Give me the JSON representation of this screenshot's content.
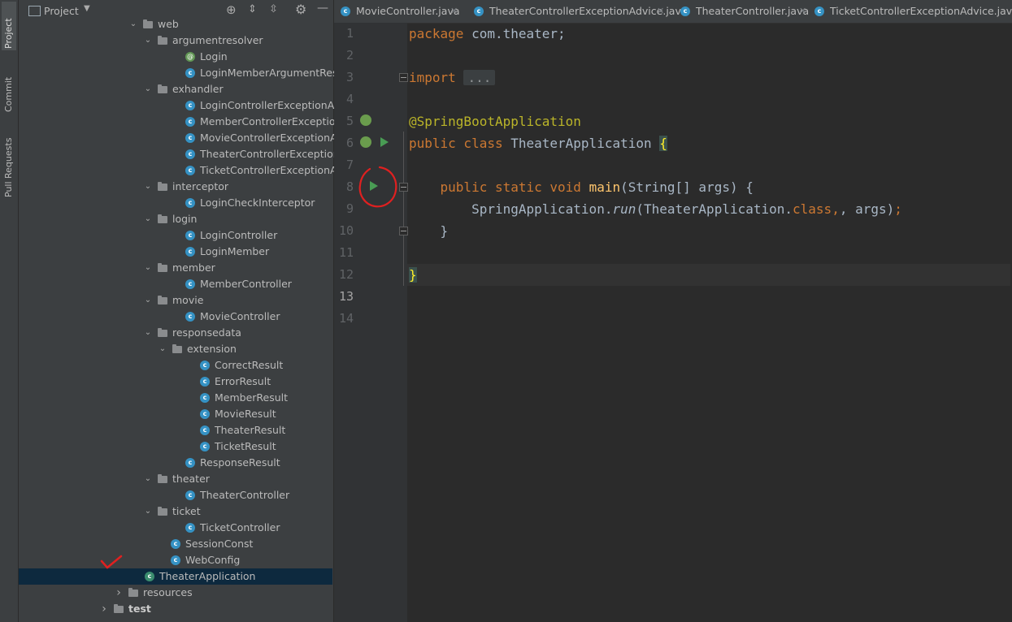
{
  "sidebar_tabs": [
    "Project",
    "Commit",
    "Pull Requests"
  ],
  "panel": {
    "title": "Project"
  },
  "tree": [
    {
      "label": "web",
      "type": "folder",
      "expanded": true,
      "indent": 0
    },
    {
      "label": "argumentresolver",
      "type": "folder",
      "expanded": true,
      "indent": 1
    },
    {
      "label": "Login",
      "type": "annotation",
      "indent": 2
    },
    {
      "label": "LoginMemberArgumentResolver",
      "type": "class",
      "indent": 2
    },
    {
      "label": "exhandler",
      "type": "folder",
      "expanded": true,
      "indent": 1
    },
    {
      "label": "LoginControllerExceptionAdvice",
      "type": "class",
      "indent": 2
    },
    {
      "label": "MemberControllerExceptionAdvice",
      "type": "class",
      "indent": 2
    },
    {
      "label": "MovieControllerExceptionAdvice",
      "type": "class",
      "indent": 2
    },
    {
      "label": "TheaterControllerExceptionAdvice",
      "type": "class",
      "indent": 2
    },
    {
      "label": "TicketControllerExceptionAdvice",
      "type": "class",
      "indent": 2
    },
    {
      "label": "interceptor",
      "type": "folder",
      "expanded": true,
      "indent": 1
    },
    {
      "label": "LoginCheckInterceptor",
      "type": "class",
      "indent": 2
    },
    {
      "label": "login",
      "type": "folder",
      "expanded": true,
      "indent": 1
    },
    {
      "label": "LoginController",
      "type": "class",
      "indent": 2
    },
    {
      "label": "LoginMember",
      "type": "class",
      "indent": 2
    },
    {
      "label": "member",
      "type": "folder",
      "expanded": true,
      "indent": 1
    },
    {
      "label": "MemberController",
      "type": "class",
      "indent": 2
    },
    {
      "label": "movie",
      "type": "folder",
      "expanded": true,
      "indent": 1
    },
    {
      "label": "MovieController",
      "type": "class",
      "indent": 2
    },
    {
      "label": "responsedata",
      "type": "folder",
      "expanded": true,
      "indent": 1
    },
    {
      "label": "extension",
      "type": "folder",
      "expanded": true,
      "indent": 2
    },
    {
      "label": "CorrectResult",
      "type": "class",
      "indent": 3
    },
    {
      "label": "ErrorResult",
      "type": "class",
      "indent": 3
    },
    {
      "label": "MemberResult",
      "type": "class",
      "indent": 3
    },
    {
      "label": "MovieResult",
      "type": "class",
      "indent": 3
    },
    {
      "label": "TheaterResult",
      "type": "class",
      "indent": 3
    },
    {
      "label": "TicketResult",
      "type": "class",
      "indent": 3
    },
    {
      "label": "ResponseResult",
      "type": "class",
      "indent": 2
    },
    {
      "label": "theater",
      "type": "folder",
      "expanded": true,
      "indent": 1
    },
    {
      "label": "TheaterController",
      "type": "class",
      "indent": 2
    },
    {
      "label": "ticket",
      "type": "folder",
      "expanded": true,
      "indent": 1
    },
    {
      "label": "TicketController",
      "type": "class",
      "indent": 2
    },
    {
      "label": "SessionConst",
      "type": "class",
      "indent": 1
    },
    {
      "label": "WebConfig",
      "type": "class",
      "indent": 1
    },
    {
      "label": "TheaterApplication",
      "type": "spring",
      "indent": 0,
      "selected": true
    },
    {
      "label": "resources",
      "type": "resfolder",
      "expanded": false,
      "indent": -1
    },
    {
      "label": "test",
      "type": "folder",
      "expanded": false,
      "indent": -2
    }
  ],
  "tabs": [
    {
      "label": "MovieController.java"
    },
    {
      "label": "TheaterControllerExceptionAdvice.java"
    },
    {
      "label": "TheaterController.java"
    },
    {
      "label": "TicketControllerExceptionAdvice.java"
    }
  ],
  "line_numbers": [
    "1",
    "2",
    "3",
    "4",
    "5",
    "6",
    "7",
    "8",
    "9",
    "10",
    "11",
    "12",
    "13",
    "14"
  ],
  "code": {
    "l1_kw": "package",
    "l1_rest": " com.theater;",
    "l3_kw": "import",
    "l3_fold": "...",
    "l6_ann": "@SpringBootApplication",
    "l7_kw": "public class",
    "l7_name": " TheaterApplication ",
    "l7_brace": "{",
    "l9_indent": "    ",
    "l9_kw": "public static void",
    "l9_sp": " ",
    "l9_fn": "main",
    "l9_rest": "(String[] args) {",
    "l10_indent": "        ",
    "l10_a": "SpringApplication.",
    "l10_run": "run",
    "l10_b": "(TheaterApplication.",
    "l10_cls": "class",
    "l10_c": ", args)",
    "l10_semi": ";",
    "l11": "    }",
    "l13": "}"
  },
  "colors": {
    "accent": "#3592c4",
    "run": "#499c54",
    "annotation_mark": "#e02020"
  }
}
